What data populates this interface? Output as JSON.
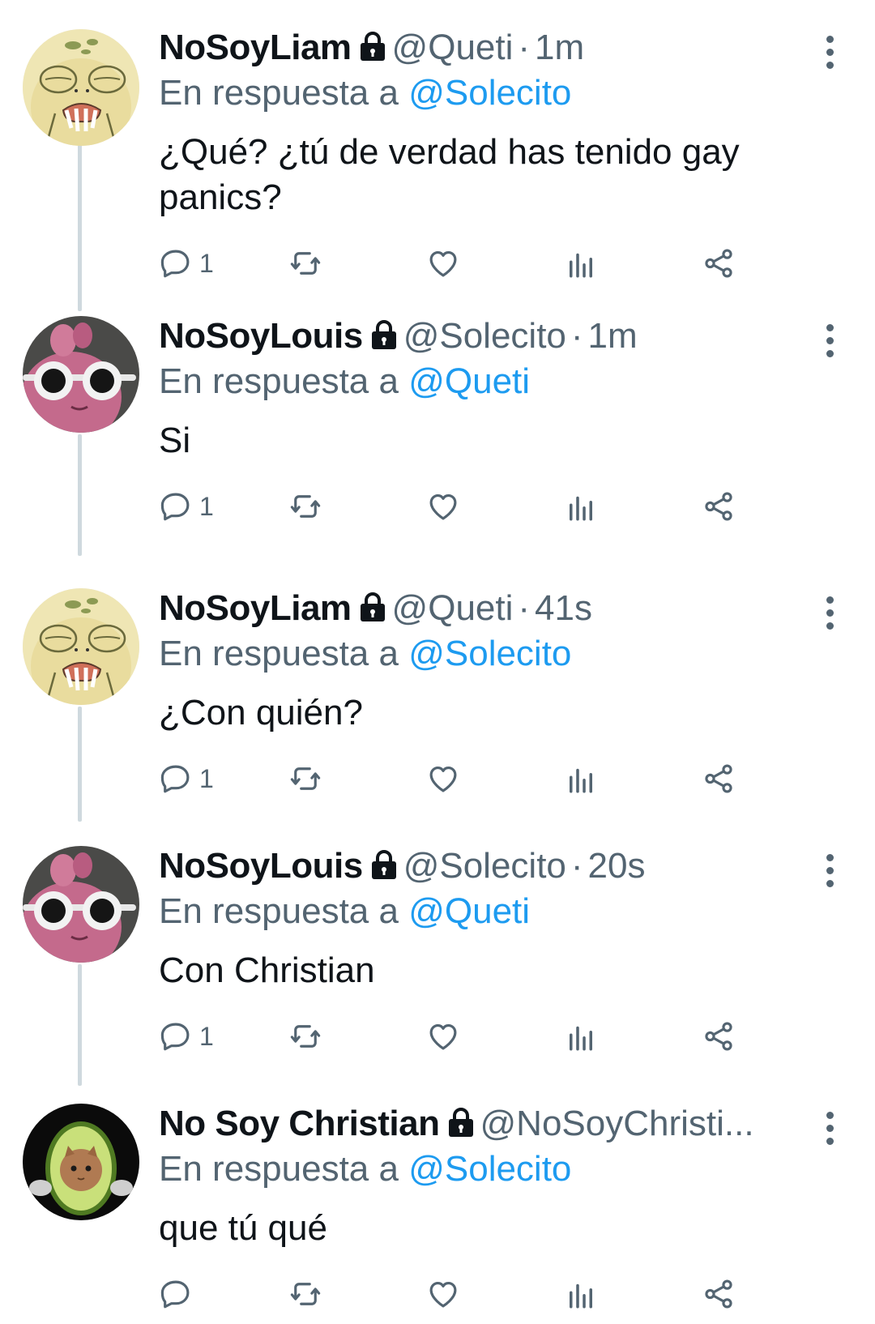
{
  "reply_prefix": "En respuesta a",
  "icons": {
    "lock": "lock-icon",
    "more": "more-vertical-icon",
    "reply": "reply-icon",
    "retweet": "retweet-icon",
    "like": "heart-icon",
    "views": "views-chart-icon",
    "share": "share-icon"
  },
  "colors": {
    "mention": "#1d9bf0",
    "secondary_text": "#536471",
    "thread_line": "#cfd9de"
  },
  "tweets": [
    {
      "name": "NoSoyLiam",
      "handle": "@Queti",
      "separator": "·",
      "time": "1m",
      "reply_to": "@Solecito",
      "text": "¿Qué? ¿tú de verdad has tenido gay panics?",
      "reply_count": "1"
    },
    {
      "name": "NoSoyLouis",
      "handle": "@Solecito",
      "separator": "·",
      "time": "1m",
      "reply_to": "@Queti",
      "text": "Si",
      "reply_count": "1"
    },
    {
      "name": "NoSoyLiam",
      "handle": "@Queti",
      "separator": "·",
      "time": "41s",
      "reply_to": "@Solecito",
      "text": "¿Con quién?",
      "reply_count": "1"
    },
    {
      "name": "NoSoyLouis",
      "handle": "@Solecito",
      "separator": "·",
      "time": "20s",
      "reply_to": "@Queti",
      "text": "Con Christian",
      "reply_count": "1"
    },
    {
      "name": "No Soy Christian",
      "handle": "@NoSoyChristi...",
      "separator": "",
      "time": "",
      "reply_to": "@Solecito",
      "text": "que tú qué",
      "reply_count": ""
    }
  ]
}
